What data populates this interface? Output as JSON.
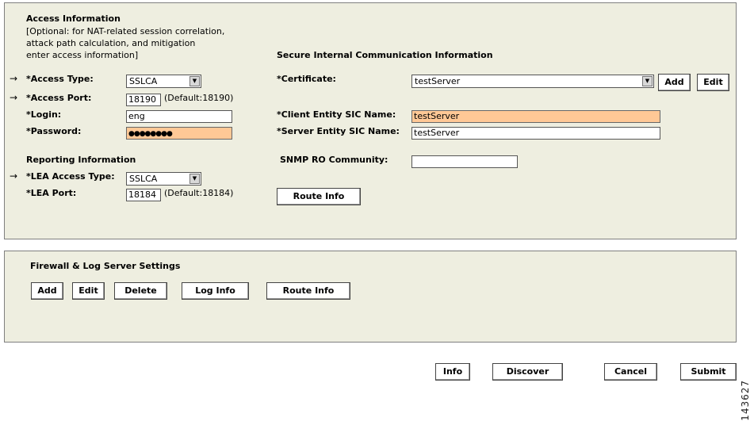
{
  "access": {
    "heading": "Access Information",
    "note": "[Optional: for NAT-related session correlation,\nattack path calculation, and mitigation\nenter access information]",
    "access_type_label": "*Access Type:",
    "access_type_value": "SSLCA",
    "access_port_label": "*Access Port:",
    "access_port_value": "18190",
    "access_port_default": "(Default:18190)",
    "login_label": "*Login:",
    "login_value": "eng",
    "password_label": "*Password:",
    "password_value": "●●●●●●●●"
  },
  "reporting": {
    "heading": "Reporting Information",
    "lea_type_label": "*LEA Access Type:",
    "lea_type_value": "SSLCA",
    "lea_port_label": "*LEA Port:",
    "lea_port_value": "18184",
    "lea_port_default": "(Default:18184)"
  },
  "sic": {
    "heading": "Secure Internal Communication Information",
    "certificate_label": "*Certificate:",
    "certificate_value": "testServer",
    "add_label": "Add",
    "edit_label": "Edit",
    "client_label": "*Client Entity SIC Name:",
    "client_value": "testServer",
    "server_label": "*Server Entity SIC Name:",
    "server_value": "testServer",
    "snmp_label": "SNMP RO Community:",
    "snmp_value": "",
    "route_info_label": "Route Info"
  },
  "firewall": {
    "heading": "Firewall & Log Server Settings",
    "add_label": "Add",
    "edit_label": "Edit",
    "delete_label": "Delete",
    "log_info_label": "Log Info",
    "route_info_label": "Route Info"
  },
  "footer": {
    "info_label": "Info",
    "discover_label": "Discover",
    "cancel_label": "Cancel",
    "submit_label": "Submit"
  },
  "side_number": "143627",
  "icons": {
    "row_arrow": "right-arrow-icon",
    "dropdown": "chevron-down-icon"
  }
}
